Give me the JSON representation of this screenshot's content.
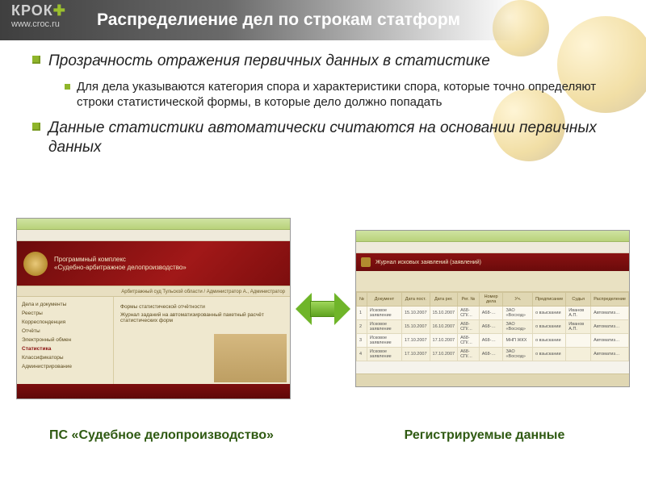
{
  "brand": {
    "name": "КРОК",
    "url": "www.croc.ru"
  },
  "slide_title": "Распределиение дел по строкам статформ",
  "points": [
    {
      "lead": "Прозрачность отражения первичных данных в статистике",
      "subs": [
        "Для дела указываются категория спора и характеристики спора, которые точно определяют строки статистической формы, в которые дело должно попадать"
      ]
    },
    {
      "lead": "Данные статистики автоматически считаются на основании первичных данных",
      "subs": []
    }
  ],
  "screenshot1": {
    "banner_line1": "Программный комплекс",
    "banner_line2": "«Судебно-арбитражное делопроизводство»",
    "crumb": "Арбитражный суд Тульской области / Администратор А., Администратор",
    "side_items": [
      "Дела и документы",
      "Реестры",
      "Корреспонденция",
      "Отчёты",
      "Электронный обмен",
      "Статистика",
      "Классификаторы",
      "Администрирование"
    ],
    "side_selected_index": 5,
    "main_lines": [
      "Формы статистической отчётности",
      "Журнал заданий на автоматизированный пакетный расчёт статистических форм"
    ]
  },
  "screenshot2": {
    "header": "Журнал исковых заявлений (заявлений)",
    "columns": [
      "№",
      "Документ",
      "Дата пост.",
      "Дата рег.",
      "Рег. №",
      "Номер дела",
      "Уч.",
      "Предписание",
      "Судья",
      "Распределение"
    ],
    "rows": [
      [
        "1",
        "Исковое заявление",
        "15.10.2007",
        "15.10.2007",
        "А68-СП/…",
        "А68-…",
        "ЗАО «Восход»",
        "о взыскании",
        "Иванов А.П.",
        "Автоматиз…"
      ],
      [
        "2",
        "Исковое заявление",
        "15.10.2007",
        "16.10.2007",
        "А68-СП/…",
        "А68-…",
        "ЗАО «Восход»",
        "о взыскании",
        "Иванов А.П.",
        "Автоматиз…"
      ],
      [
        "3",
        "Исковое заявление",
        "17.10.2007",
        "17.10.2007",
        "А68-СП/…",
        "А68-…",
        "МНП ЖКХ",
        "о взыскании",
        "",
        "Автоматиз…"
      ],
      [
        "4",
        "Исковое заявление",
        "17.10.2007",
        "17.10.2007",
        "А68-СП/…",
        "А68-…",
        "ЗАО «Восход»",
        "о взыскании",
        "",
        "Автоматиз…"
      ]
    ]
  },
  "captions": {
    "left": "ПС «Судебное делопроизводство»",
    "right": "Регистрируемые данные"
  }
}
